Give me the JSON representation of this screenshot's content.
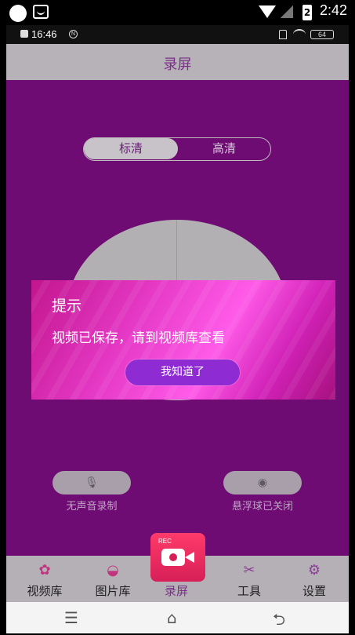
{
  "device_status": {
    "time": "2:42",
    "battery": "2"
  },
  "inner_status": {
    "time": "16:46",
    "battery": "64"
  },
  "header": {
    "title": "录屏"
  },
  "quality": {
    "options": [
      "标清",
      "高清"
    ],
    "selected": "标清"
  },
  "controls": {
    "mic": {
      "icon": "mic-icon",
      "caption": "无声音录制"
    },
    "float": {
      "icon": "float-ball-icon",
      "caption": "悬浮球已关闭"
    }
  },
  "dialog": {
    "title": "提示",
    "message": "视频已保存，请到视频库查看",
    "button": "我知道了"
  },
  "rec_badge": "REC",
  "tabs": [
    {
      "label": "视频库",
      "icon": "film-reel-icon"
    },
    {
      "label": "图片库",
      "icon": "lips-icon"
    },
    {
      "label": "录屏",
      "icon": "record-camera-icon",
      "active": true
    },
    {
      "label": "工具",
      "icon": "scissors-icon"
    },
    {
      "label": "设置",
      "icon": "gear-icon"
    }
  ],
  "colors": {
    "accent": "#7a2f8a",
    "background": "#6f0c73",
    "dialog": "#e63ac8",
    "button": "#8e2bd3",
    "rec": "#ff3b6a"
  }
}
